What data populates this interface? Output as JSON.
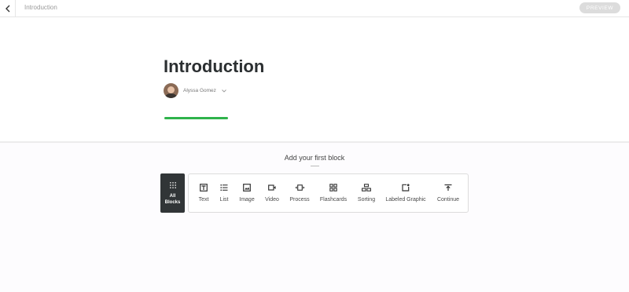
{
  "topbar": {
    "title": "Introduction",
    "preview_label": "PREVIEW"
  },
  "lesson": {
    "title": "Introduction",
    "author": "Alyssa Gomez",
    "progress": 1.0
  },
  "colors": {
    "accent": "#2fb34b",
    "dark": "#313537"
  },
  "add_block": {
    "heading": "Add your first block"
  },
  "all_blocks": {
    "line1": "All",
    "line2": "Blocks"
  },
  "blocks": [
    {
      "label": "Text",
      "icon": "text-icon"
    },
    {
      "label": "List",
      "icon": "list-icon"
    },
    {
      "label": "Image",
      "icon": "image-icon"
    },
    {
      "label": "Video",
      "icon": "video-icon"
    },
    {
      "label": "Process",
      "icon": "process-icon"
    },
    {
      "label": "Flashcards",
      "icon": "flashcards-icon"
    },
    {
      "label": "Sorting",
      "icon": "sorting-icon"
    },
    {
      "label": "Labeled Graphic",
      "icon": "labeled-graphic-icon"
    },
    {
      "label": "Continue",
      "icon": "continue-icon"
    }
  ]
}
